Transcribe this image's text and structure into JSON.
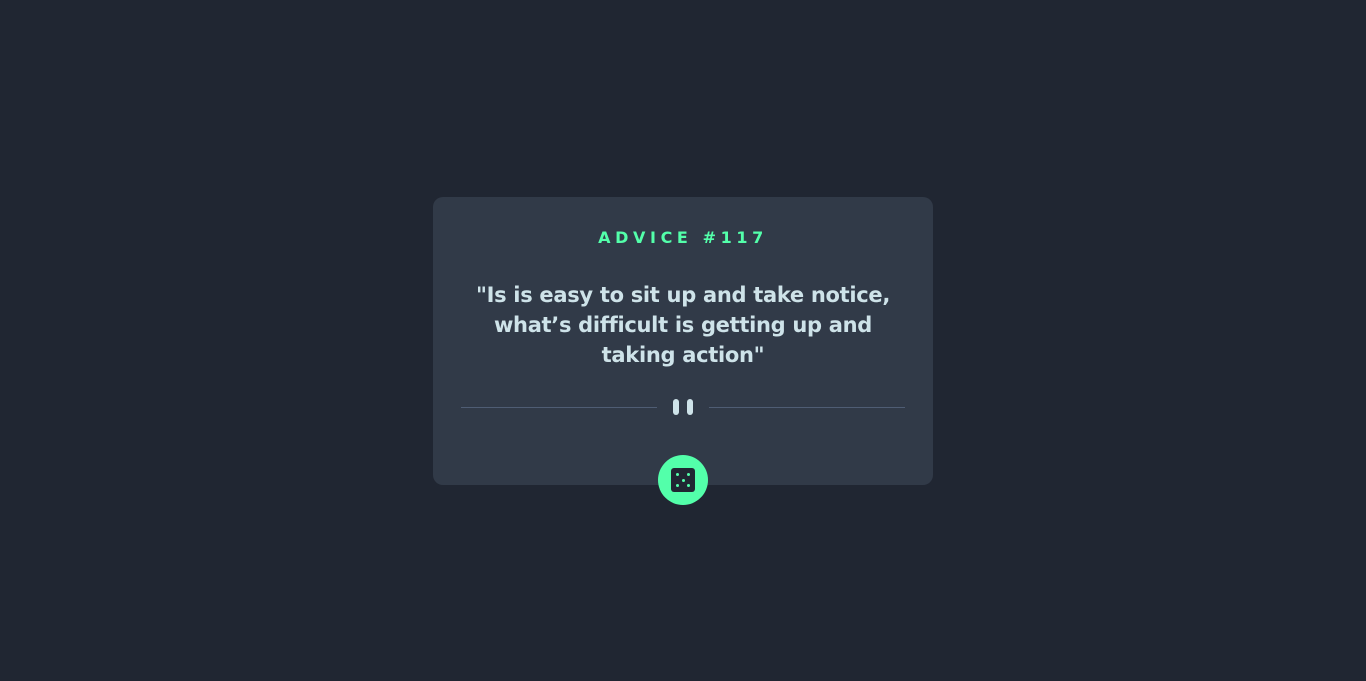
{
  "card": {
    "advice_label": "ADVICE #117",
    "quote": "\"Is is easy to sit up and take notice, what’s difficult is getting up and taking action\""
  },
  "icons": {
    "divider": "pause-icon",
    "button": "dice-icon"
  },
  "colors": {
    "background": "#202632",
    "card": "#313a48",
    "accent": "#53ffaa",
    "text": "#cee3e9",
    "divider": "#4f5d74"
  }
}
